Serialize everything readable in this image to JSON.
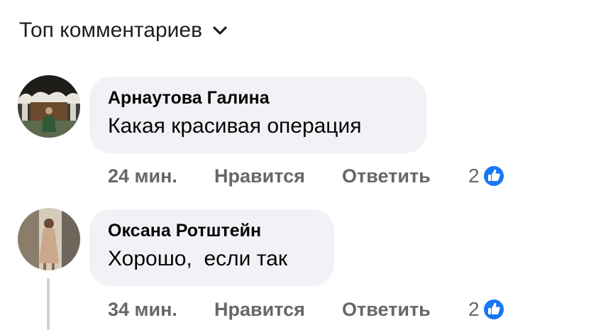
{
  "sort": {
    "label": "Топ комментариев"
  },
  "comments": [
    {
      "author": "Арнаутова Галина",
      "text": "Какая красивая операция",
      "time": "24 мин.",
      "like_label": "Нравится",
      "reply_label": "Ответить",
      "reaction_count": "2"
    },
    {
      "author": "Оксана Ротштейн",
      "text": "Хорошо,  если так",
      "time": "34 мин.",
      "like_label": "Нравится",
      "reply_label": "Ответить",
      "reaction_count": "2"
    }
  ],
  "colors": {
    "bubble": "#f0f2f5",
    "meta": "#65676b",
    "like_blue": "#1877f2"
  },
  "icons": {
    "sort": "chevron-down-icon",
    "reaction": "thumbs-up-icon"
  }
}
